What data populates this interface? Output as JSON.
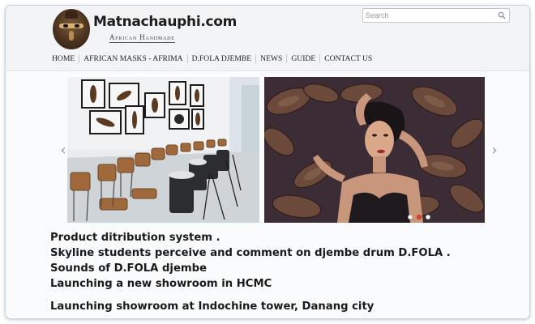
{
  "site": {
    "name": "Matnachauphi.com",
    "tagline": "African Handmade"
  },
  "search": {
    "placeholder": "Search",
    "icon": "magnifier-icon"
  },
  "nav": {
    "items": [
      {
        "label": "HOME"
      },
      {
        "label": "AFRICAN MASKS - AFRIMA"
      },
      {
        "label": "D.FOLA DJEMBE"
      },
      {
        "label": "NEWS"
      },
      {
        "label": "GUIDE"
      },
      {
        "label": "CONTACT US"
      }
    ]
  },
  "slider": {
    "prev_glyph": "‹",
    "next_glyph": "›",
    "dots": [
      false,
      true,
      false
    ]
  },
  "articles": [
    {
      "title": "Product ditribution system ."
    },
    {
      "title": "Skyline students perceive and comment on djembe drum D.FOLA ."
    },
    {
      "title": "Sounds of D.FOLA djembe"
    },
    {
      "title": "Launching a new showroom in HCMC"
    },
    {
      "title": "Launching showroom at Indochine tower, Danang city"
    }
  ],
  "colors": {
    "accent_dot": "#d9442d",
    "text": "#1a1a1a"
  }
}
